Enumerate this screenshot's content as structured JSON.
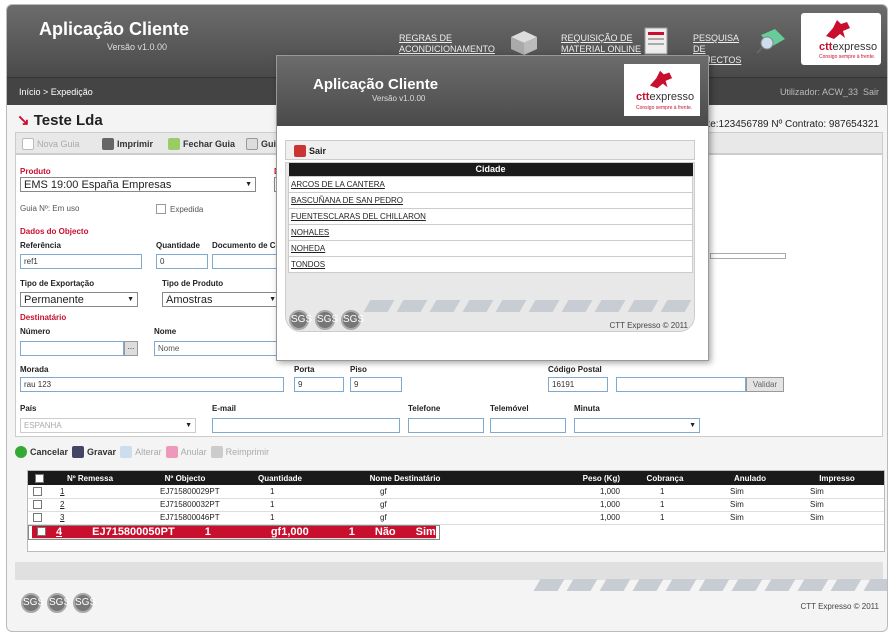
{
  "header": {
    "title": "Aplicação Cliente",
    "version": "Versão v1.0.00",
    "links": [
      "REGRAS DE ACONDICIONAMENTO",
      "REQUISIÇÃO DE MATERIAL ONLINE",
      "PESQUISA DE OBJECTOS"
    ],
    "brand_ctt": "ctt",
    "brand_expresso": "expresso",
    "tagline": "Consigo sempre à frente."
  },
  "nav": {
    "breadcrumb": "Início > Expedição",
    "user": "Utilizador: ACW_33",
    "logout": "Sair"
  },
  "company": {
    "name": "Teste Lda",
    "contract": "te:123456789  Nº Contrato: 987654321"
  },
  "toolbar": {
    "nova": "Nova Guia",
    "imprimir": "Imprimir",
    "fechar": "Fechar Guia",
    "guia": "Guia"
  },
  "form": {
    "produto_label": "Produto",
    "produto_value": "EMS 19:00 España Empresas",
    "d_label": "D",
    "guia_label": "Guia Nº: Em uso",
    "expedida": "Expedida",
    "dados_label": "Dados do Objecto",
    "referencia_label": "Referência",
    "referencia_value": "ref1",
    "quantidade_label": "Quantidade",
    "quantidade_value": "0",
    "documento_label": "Documento de Co",
    "tipo_exp_label": "Tipo de Exportação",
    "tipo_exp_value": "Permanente",
    "tipo_prod_label": "Tipo de Produto",
    "tipo_prod_value": "Amostras",
    "destinatario_label": "Destinatário",
    "numero_label": "Número",
    "dots": "...",
    "nome_label": "Nome",
    "nome_value": "Nome",
    "morada_label": "Morada",
    "morada_value": "rau 123",
    "porta_label": "Porta",
    "porta_value": "9",
    "piso_label": "Piso",
    "piso_value": "9",
    "cp_label": "Código Postal",
    "cp_value": "16191",
    "validar": "Validar",
    "pais_label": "País",
    "pais_value": "ESPANHA",
    "email_label": "E-mail",
    "telefone_label": "Telefone",
    "telemovel_label": "Telemóvel",
    "minuta_label": "Minuta"
  },
  "actions": {
    "cancelar": "Cancelar",
    "gravar": "Gravar",
    "alterar": "Alterar",
    "anular": "Anular",
    "reimprimir": "Reimprimir"
  },
  "table": {
    "headers": [
      "Nº Remessa",
      "Nº Objecto",
      "Quantidade",
      "Nome Destinatário",
      "Peso (Kg)",
      "Cobrança",
      "Anulado",
      "Impresso"
    ],
    "rows": [
      [
        "1",
        "EJ715800029PT",
        "1",
        "gf",
        "1,000",
        "1",
        "Sim",
        "Sim"
      ],
      [
        "2",
        "EJ715800032PT",
        "1",
        "gf",
        "1,000",
        "1",
        "Sim",
        "Sim"
      ],
      [
        "3",
        "EJ715800046PT",
        "1",
        "gf",
        "1,000",
        "1",
        "Sim",
        "Sim"
      ],
      [
        "4",
        "EJ715800050PT",
        "1",
        "gf",
        "1,000",
        "1",
        "Não",
        "Sim"
      ]
    ]
  },
  "footer": {
    "copyright": "CTT Expresso © 2011",
    "cert": "SGS"
  },
  "modal": {
    "title": "Aplicação Cliente",
    "version": "Versão v1.0.00",
    "sair": "Sair",
    "column": "Cidade",
    "cities": [
      "ARCOS DE LA CANTERA",
      "BASCUÑANA DE SAN PEDRO",
      "FUENTESCLARAS DEL CHILLARON",
      "NOHALES",
      "NOHEDA",
      "TONDOS"
    ],
    "copyright": "CTT Expresso © 2011"
  },
  "colors": {
    "accent": "#c8102e",
    "header": "#555555",
    "table_header": "#1a1a1a"
  }
}
